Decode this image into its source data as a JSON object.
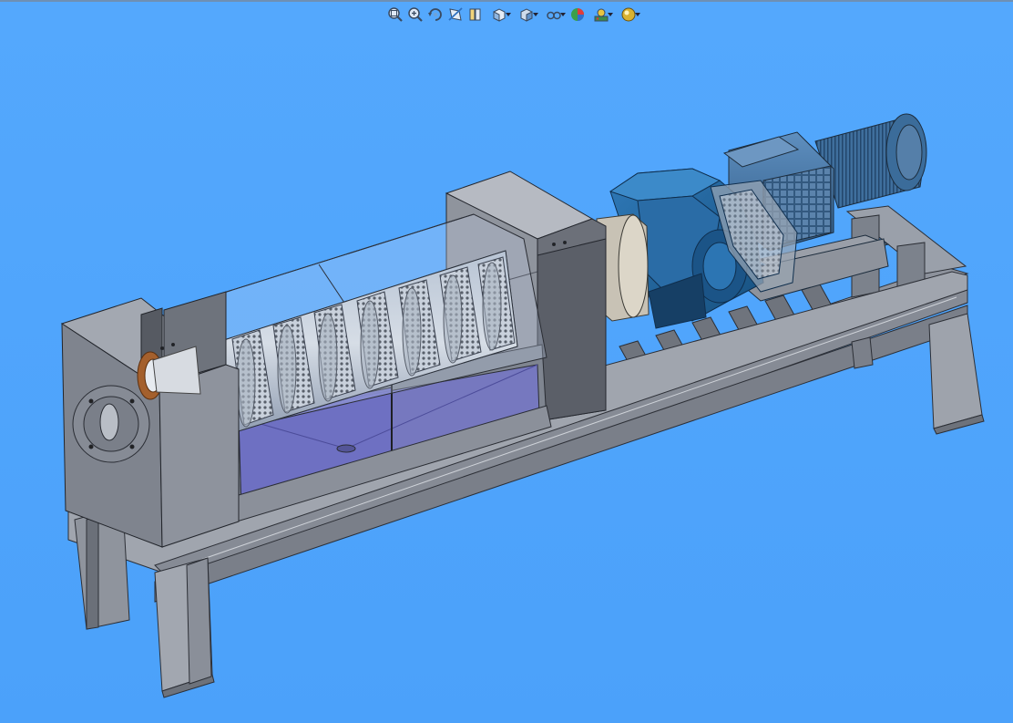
{
  "viewport": {
    "background_color": "#4ea4fc",
    "model": "screw-press-separator-assembly"
  },
  "heads_up_toolbar": {
    "buttons": [
      {
        "name": "zoom-to-fit",
        "icon": "zoom-fit-icon",
        "dropdown": false
      },
      {
        "name": "zoom-to-area",
        "icon": "zoom-area-icon",
        "dropdown": false
      },
      {
        "name": "previous-view",
        "icon": "previous-view-icon",
        "dropdown": false
      },
      {
        "name": "section-view",
        "icon": "section-view-icon",
        "dropdown": false
      },
      {
        "name": "dynamic-annotation-views",
        "icon": "annotation-view-icon",
        "dropdown": false
      },
      {
        "name": "view-orientation",
        "icon": "view-orientation-icon",
        "dropdown": true
      },
      {
        "name": "display-style",
        "icon": "display-style-icon",
        "dropdown": true
      },
      {
        "name": "hide-show-items",
        "icon": "hide-show-icon",
        "dropdown": true
      },
      {
        "name": "edit-appearance",
        "icon": "edit-appearance-icon",
        "dropdown": false
      },
      {
        "name": "apply-scene",
        "icon": "apply-scene-icon",
        "dropdown": true
      },
      {
        "name": "view-settings",
        "icon": "view-settings-icon",
        "dropdown": true
      }
    ]
  }
}
